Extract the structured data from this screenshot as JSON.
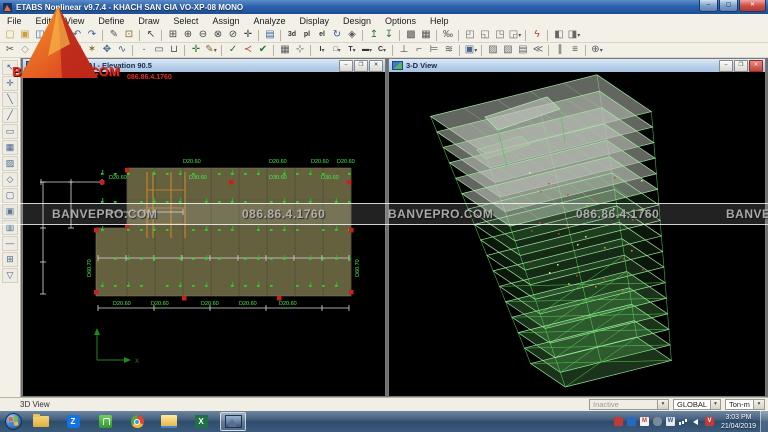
{
  "title_bar": {
    "title": "ETABS Nonlinear v9.7.4 - KHACH SAN GIA VO-XP-08 MONO",
    "controls": [
      {
        "name": "minimize",
        "glyph": "–"
      },
      {
        "name": "maximize",
        "glyph": "▢"
      },
      {
        "name": "close",
        "glyph": "✕"
      }
    ]
  },
  "menu_bar": [
    "File",
    "Edit",
    "View",
    "Define",
    "Draw",
    "Select",
    "Assign",
    "Analyze",
    "Display",
    "Design",
    "Options",
    "Help"
  ],
  "toolbar_row1": [
    {
      "name": "new-model",
      "glyph": "▢",
      "c": "#c8a03a"
    },
    {
      "name": "open-file",
      "glyph": "▣",
      "c": "#c8a03a"
    },
    {
      "name": "save-file",
      "glyph": "◫",
      "c": "#3b6aa0"
    },
    {
      "name": "print",
      "glyph": "▥",
      "c": "#666"
    },
    {
      "sep": true
    },
    {
      "name": "undo",
      "glyph": "↶",
      "c": "#3a5a9a"
    },
    {
      "name": "redo",
      "glyph": "↷",
      "c": "#3a5a9a"
    },
    {
      "sep": true
    },
    {
      "name": "edit-pencil",
      "glyph": "✎",
      "c": "#555"
    },
    {
      "name": "lock-model",
      "glyph": "⊡",
      "c": "#8a6a2a"
    },
    {
      "sep": true
    },
    {
      "name": "pointer",
      "glyph": "↖",
      "c": "#444"
    },
    {
      "sep": true
    },
    {
      "name": "rubber-band-zoom",
      "glyph": "⊞",
      "c": "#444"
    },
    {
      "name": "zoom-in",
      "glyph": "⊕",
      "c": "#444"
    },
    {
      "name": "zoom-out",
      "glyph": "⊖",
      "c": "#444"
    },
    {
      "name": "zoom-full",
      "glyph": "⊗",
      "c": "#444"
    },
    {
      "name": "zoom-previous",
      "glyph": "⊘",
      "c": "#444"
    },
    {
      "name": "pan",
      "glyph": "✛",
      "c": "#444"
    },
    {
      "sep": true
    },
    {
      "name": "page-view",
      "glyph": "▤",
      "c": "#3b6aa0"
    },
    {
      "sep": true
    },
    {
      "name": "view-3d",
      "glyph": "3d",
      "text": true
    },
    {
      "name": "view-plan",
      "glyph": "pl",
      "text": true
    },
    {
      "name": "view-elevation",
      "glyph": "el",
      "text": true
    },
    {
      "name": "rotate-view",
      "glyph": "↻",
      "c": "#3a5a9a"
    },
    {
      "name": "perspective",
      "glyph": "◈",
      "c": "#555"
    },
    {
      "sep": true
    },
    {
      "name": "move-story-up",
      "glyph": "↥",
      "c": "#2a7a2a"
    },
    {
      "name": "move-story-down",
      "glyph": "↧",
      "c": "#2a7a2a"
    },
    {
      "sep": true
    },
    {
      "name": "object-shrink",
      "glyph": "▩",
      "c": "#555"
    },
    {
      "name": "set-elements",
      "glyph": "▦",
      "c": "#555"
    },
    {
      "sep": true
    },
    {
      "name": "percent",
      "glyph": "‰",
      "c": "#555"
    },
    {
      "sep": true
    },
    {
      "name": "frame-type-1",
      "glyph": "◰",
      "c": "#666"
    },
    {
      "name": "frame-type-2",
      "glyph": "◱",
      "c": "#666"
    },
    {
      "name": "frame-type-3",
      "glyph": "◳",
      "c": "#666"
    },
    {
      "name": "frame-type-4",
      "glyph": "◲",
      "c": "#666",
      "dd": true
    },
    {
      "sep": true
    },
    {
      "name": "run-analysis",
      "glyph": "ϟ",
      "c": "#b33a2a"
    },
    {
      "sep": true
    },
    {
      "name": "design-concrete",
      "glyph": "◧",
      "c": "#666"
    },
    {
      "name": "design-steel",
      "glyph": "◨",
      "c": "#666",
      "dd": true
    }
  ],
  "toolbar_row2": [
    {
      "name": "snap-points",
      "glyph": "✂",
      "c": "#555"
    },
    {
      "name": "snap-ends",
      "glyph": "◇",
      "c": "#999"
    },
    {
      "name": "snap-mid",
      "glyph": "◆",
      "c": "#999"
    },
    {
      "sep": true
    },
    {
      "name": "select-poly",
      "glyph": "⊿",
      "c": "#46648e"
    },
    {
      "name": "select-intersect",
      "glyph": "⋉",
      "c": "#46648e"
    },
    {
      "name": "select-star",
      "glyph": "✶",
      "c": "#8a6a2a"
    },
    {
      "name": "select-props",
      "glyph": "✥",
      "c": "#46648e"
    },
    {
      "name": "select-line",
      "glyph": "∿",
      "c": "#46648e"
    },
    {
      "sep": true
    },
    {
      "name": "draw-point",
      "glyph": "·",
      "c": "#222"
    },
    {
      "name": "draw-ref",
      "glyph": "▭",
      "c": "#555"
    },
    {
      "name": "draw-dim",
      "glyph": "⊔",
      "c": "#555"
    },
    {
      "sep": true
    },
    {
      "name": "measure",
      "glyph": "✛",
      "c": "#2a7a2a"
    },
    {
      "name": "note",
      "glyph": "✎",
      "c": "#8a6a2a",
      "dd": true
    },
    {
      "sep": true
    },
    {
      "name": "assign-check-1",
      "glyph": "✓",
      "c": "#2a7a2a"
    },
    {
      "name": "assign-check-2",
      "glyph": "≺",
      "c": "#b33a2a"
    },
    {
      "name": "assign-check-3",
      "glyph": "✔",
      "c": "#2a7a2a"
    },
    {
      "sep": true
    },
    {
      "name": "show-grid",
      "glyph": "▦",
      "c": "#555"
    },
    {
      "name": "show-axes",
      "glyph": "⊹",
      "c": "#555"
    },
    {
      "sep": true
    },
    {
      "name": "section-i",
      "glyph": "I",
      "text": true,
      "dd": true
    },
    {
      "name": "section-box",
      "glyph": "□",
      "text": true,
      "dd": true
    },
    {
      "name": "section-tee",
      "glyph": "T",
      "text": true,
      "dd": true
    },
    {
      "name": "section-bar",
      "glyph": "▬",
      "text": true,
      "dd": true
    },
    {
      "name": "section-c",
      "glyph": "C",
      "text": true,
      "dd": true
    },
    {
      "sep": true
    },
    {
      "name": "support",
      "glyph": "⊥",
      "c": "#555"
    },
    {
      "name": "release",
      "glyph": "⌐",
      "c": "#555"
    },
    {
      "name": "link",
      "glyph": "⊨",
      "c": "#555"
    },
    {
      "name": "spring",
      "glyph": "≋",
      "c": "#555"
    },
    {
      "sep": true
    },
    {
      "name": "mesh-area",
      "glyph": "▣",
      "c": "#46648e",
      "dd": true
    },
    {
      "sep": true
    },
    {
      "name": "load-1",
      "glyph": "▨",
      "c": "#666"
    },
    {
      "name": "load-2",
      "glyph": "▧",
      "c": "#666"
    },
    {
      "name": "load-3",
      "glyph": "▤",
      "c": "#666"
    },
    {
      "name": "load-4",
      "glyph": "≪",
      "c": "#666"
    },
    {
      "sep": true
    },
    {
      "name": "pattern-1",
      "glyph": "∥",
      "c": "#555"
    },
    {
      "name": "pattern-2",
      "glyph": "≡",
      "c": "#555"
    },
    {
      "sep": true
    },
    {
      "name": "options-more",
      "glyph": "⊕",
      "c": "#555",
      "dd": true
    }
  ],
  "side_toolbar": [
    {
      "name": "pointer-select",
      "glyph": "↖"
    },
    {
      "name": "reshape-object",
      "glyph": "✛"
    },
    {
      "name": "draw-line",
      "glyph": "╲"
    },
    {
      "name": "draw-quick-line",
      "glyph": "╱"
    },
    {
      "name": "draw-beam",
      "glyph": "▭"
    },
    {
      "name": "draw-column-grid",
      "glyph": "▦"
    },
    {
      "name": "draw-brace",
      "glyph": "▨"
    },
    {
      "name": "draw-area",
      "glyph": "◇"
    },
    {
      "name": "draw-rect-area",
      "glyph": "▢"
    },
    {
      "name": "draw-quick-area",
      "glyph": "▣"
    },
    {
      "name": "draw-wall",
      "glyph": "▥"
    },
    {
      "name": "draw-divider",
      "glyph": "—"
    },
    {
      "name": "draw-windows",
      "glyph": "⊞"
    },
    {
      "name": "draw-section-cut",
      "glyph": "▽"
    }
  ],
  "plan_window": {
    "title": "Plan View - MAI - Elevation 90.5",
    "controls": [
      {
        "name": "minimize",
        "glyph": "–"
      },
      {
        "name": "restore",
        "glyph": "❐"
      },
      {
        "name": "close",
        "glyph": "✕"
      }
    ],
    "labels": {
      "beam_top": [
        "D20.60",
        "D20.60",
        "D20.60",
        "D20.60"
      ],
      "beam_mid": [
        "D20.60",
        "D30.60",
        "D30.60",
        "D30.60"
      ],
      "beam_bottom": [
        "D20.60",
        "D20.60",
        "D20.60",
        "D20.60",
        "D20.60"
      ],
      "side_left": "D60.70",
      "side_right": "D60.70",
      "axis_x": "X"
    }
  },
  "view3d_window": {
    "title": "3-D View",
    "controls": [
      {
        "name": "minimize",
        "glyph": "–"
      },
      {
        "name": "restore",
        "glyph": "❐"
      },
      {
        "name": "close",
        "glyph": "✕"
      }
    ]
  },
  "status_bar": {
    "left_text": "3D View",
    "dropdowns": [
      {
        "name": "view-state-dropdown",
        "value": "Inactive",
        "enabled": false
      },
      {
        "name": "coord-system-dropdown",
        "value": "GLOBAL",
        "enabled": true
      },
      {
        "name": "units-dropdown",
        "value": "Ton-m",
        "enabled": true
      }
    ]
  },
  "taskbar": {
    "buttons": [
      {
        "name": "folder-app",
        "kind": "folder"
      },
      {
        "name": "zalo-app",
        "kind": "zalo",
        "letter": "Z"
      },
      {
        "name": "security-app",
        "kind": "green"
      },
      {
        "name": "chrome-app",
        "kind": "chrome"
      },
      {
        "name": "explorer-app",
        "kind": "explorer"
      },
      {
        "name": "excel-app",
        "kind": "excel",
        "letter": "X"
      },
      {
        "name": "etabs-app",
        "kind": "etabs",
        "active": true
      }
    ],
    "tray": [
      {
        "name": "notify-red-icon",
        "kind": "t-pepper"
      },
      {
        "name": "teamviewer-icon",
        "kind": "t-tv"
      },
      {
        "name": "gmail-icon",
        "kind": "t-gmail",
        "letter": "M"
      },
      {
        "name": "cloud-icon",
        "kind": "t-cloud"
      },
      {
        "name": "office-icon",
        "kind": "t-w",
        "letter": "W"
      },
      {
        "name": "network-icon",
        "kind": "t-net"
      },
      {
        "name": "volume-icon",
        "kind": "t-vol"
      },
      {
        "name": "viewer-icon",
        "kind": "t-v",
        "letter": "V"
      }
    ],
    "clock": {
      "time": "3:03 PM",
      "date": "21/04/2019"
    }
  },
  "watermark": {
    "brand": "BANVEPRO.COM",
    "phone": "086.86.4.1760",
    "band_items": [
      "BANVEPRO.COM",
      "086.86.4.1760",
      "BANVEPRO.COM",
      "086.86.4.1760",
      "BANVE"
    ]
  },
  "colors": {
    "slab_olive": "#6b6743",
    "label_green": "#44ee44",
    "node_red": "#cc2020",
    "dim_white": "#dddddd",
    "orange_line": "#d4872a",
    "axis_green": "#1d8a1d",
    "wire_green": "#49c949"
  }
}
